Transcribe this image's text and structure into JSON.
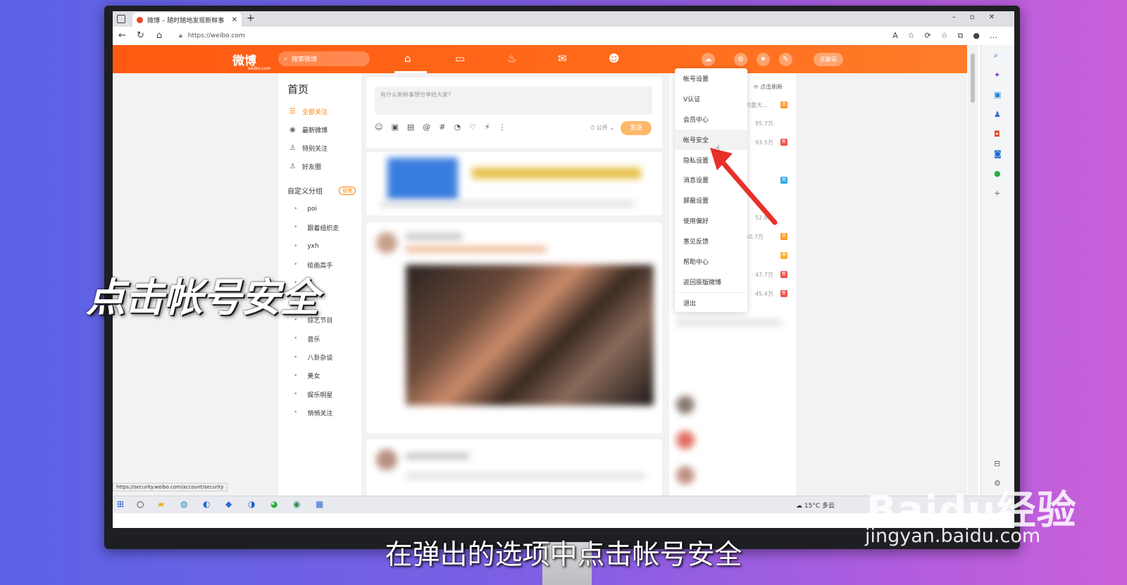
{
  "browser": {
    "tab_title": "微博 – 随时随地发现新鲜事",
    "url": "https://weibo.com",
    "status_url": "https://security.weibo.com/account/security"
  },
  "header": {
    "logo": "微博",
    "logo_sub": "weibo.com",
    "search_placeholder": "搜索微博",
    "user_button": "无聊哥"
  },
  "left_nav": {
    "title": "首页",
    "items": [
      "全部关注",
      "最新微博",
      "特别关注",
      "好友圈"
    ],
    "group_title": "自定义分组",
    "group_manage": "管理",
    "groups": [
      "poi",
      "跟着组织走",
      "yxh",
      "绘画高手",
      "…",
      "…",
      "综艺节目",
      "音乐",
      "八卦杂谈",
      "美女",
      "娱乐明星",
      "悄悄关注"
    ]
  },
  "composer": {
    "placeholder": "有什么新鲜事想分享给大家?",
    "visibility": "公开",
    "send": "发送"
  },
  "right_panel": {
    "refresh": "点击刷新",
    "rows": [
      "的重大...",
      "95.7万",
      "93.5万",
      "52.6万",
      "50.7万",
      "47.7万",
      "45.4万"
    ]
  },
  "account_menu": {
    "items": [
      "帐号设置",
      "V认证",
      "会员中心",
      "帐号安全",
      "隐私设置",
      "消息设置",
      "屏蔽设置",
      "使用偏好",
      "意见反馈",
      "帮助中心",
      "返回原版微博",
      "退出"
    ],
    "highlighted": "帐号安全"
  },
  "taskbar": {
    "weather": "15°C 多云"
  },
  "overlay": {
    "big_caption": "点击帐号安全",
    "subtitle": "在弹出的选项中点击帐号安全",
    "watermark": "Baidu经验",
    "watermark_url": "jingyan.baidu.com"
  },
  "colors": {
    "weibo_orange": "#ff5a12",
    "menu_highlight": "#f2f2f2",
    "arrow_red": "#e8302a"
  }
}
